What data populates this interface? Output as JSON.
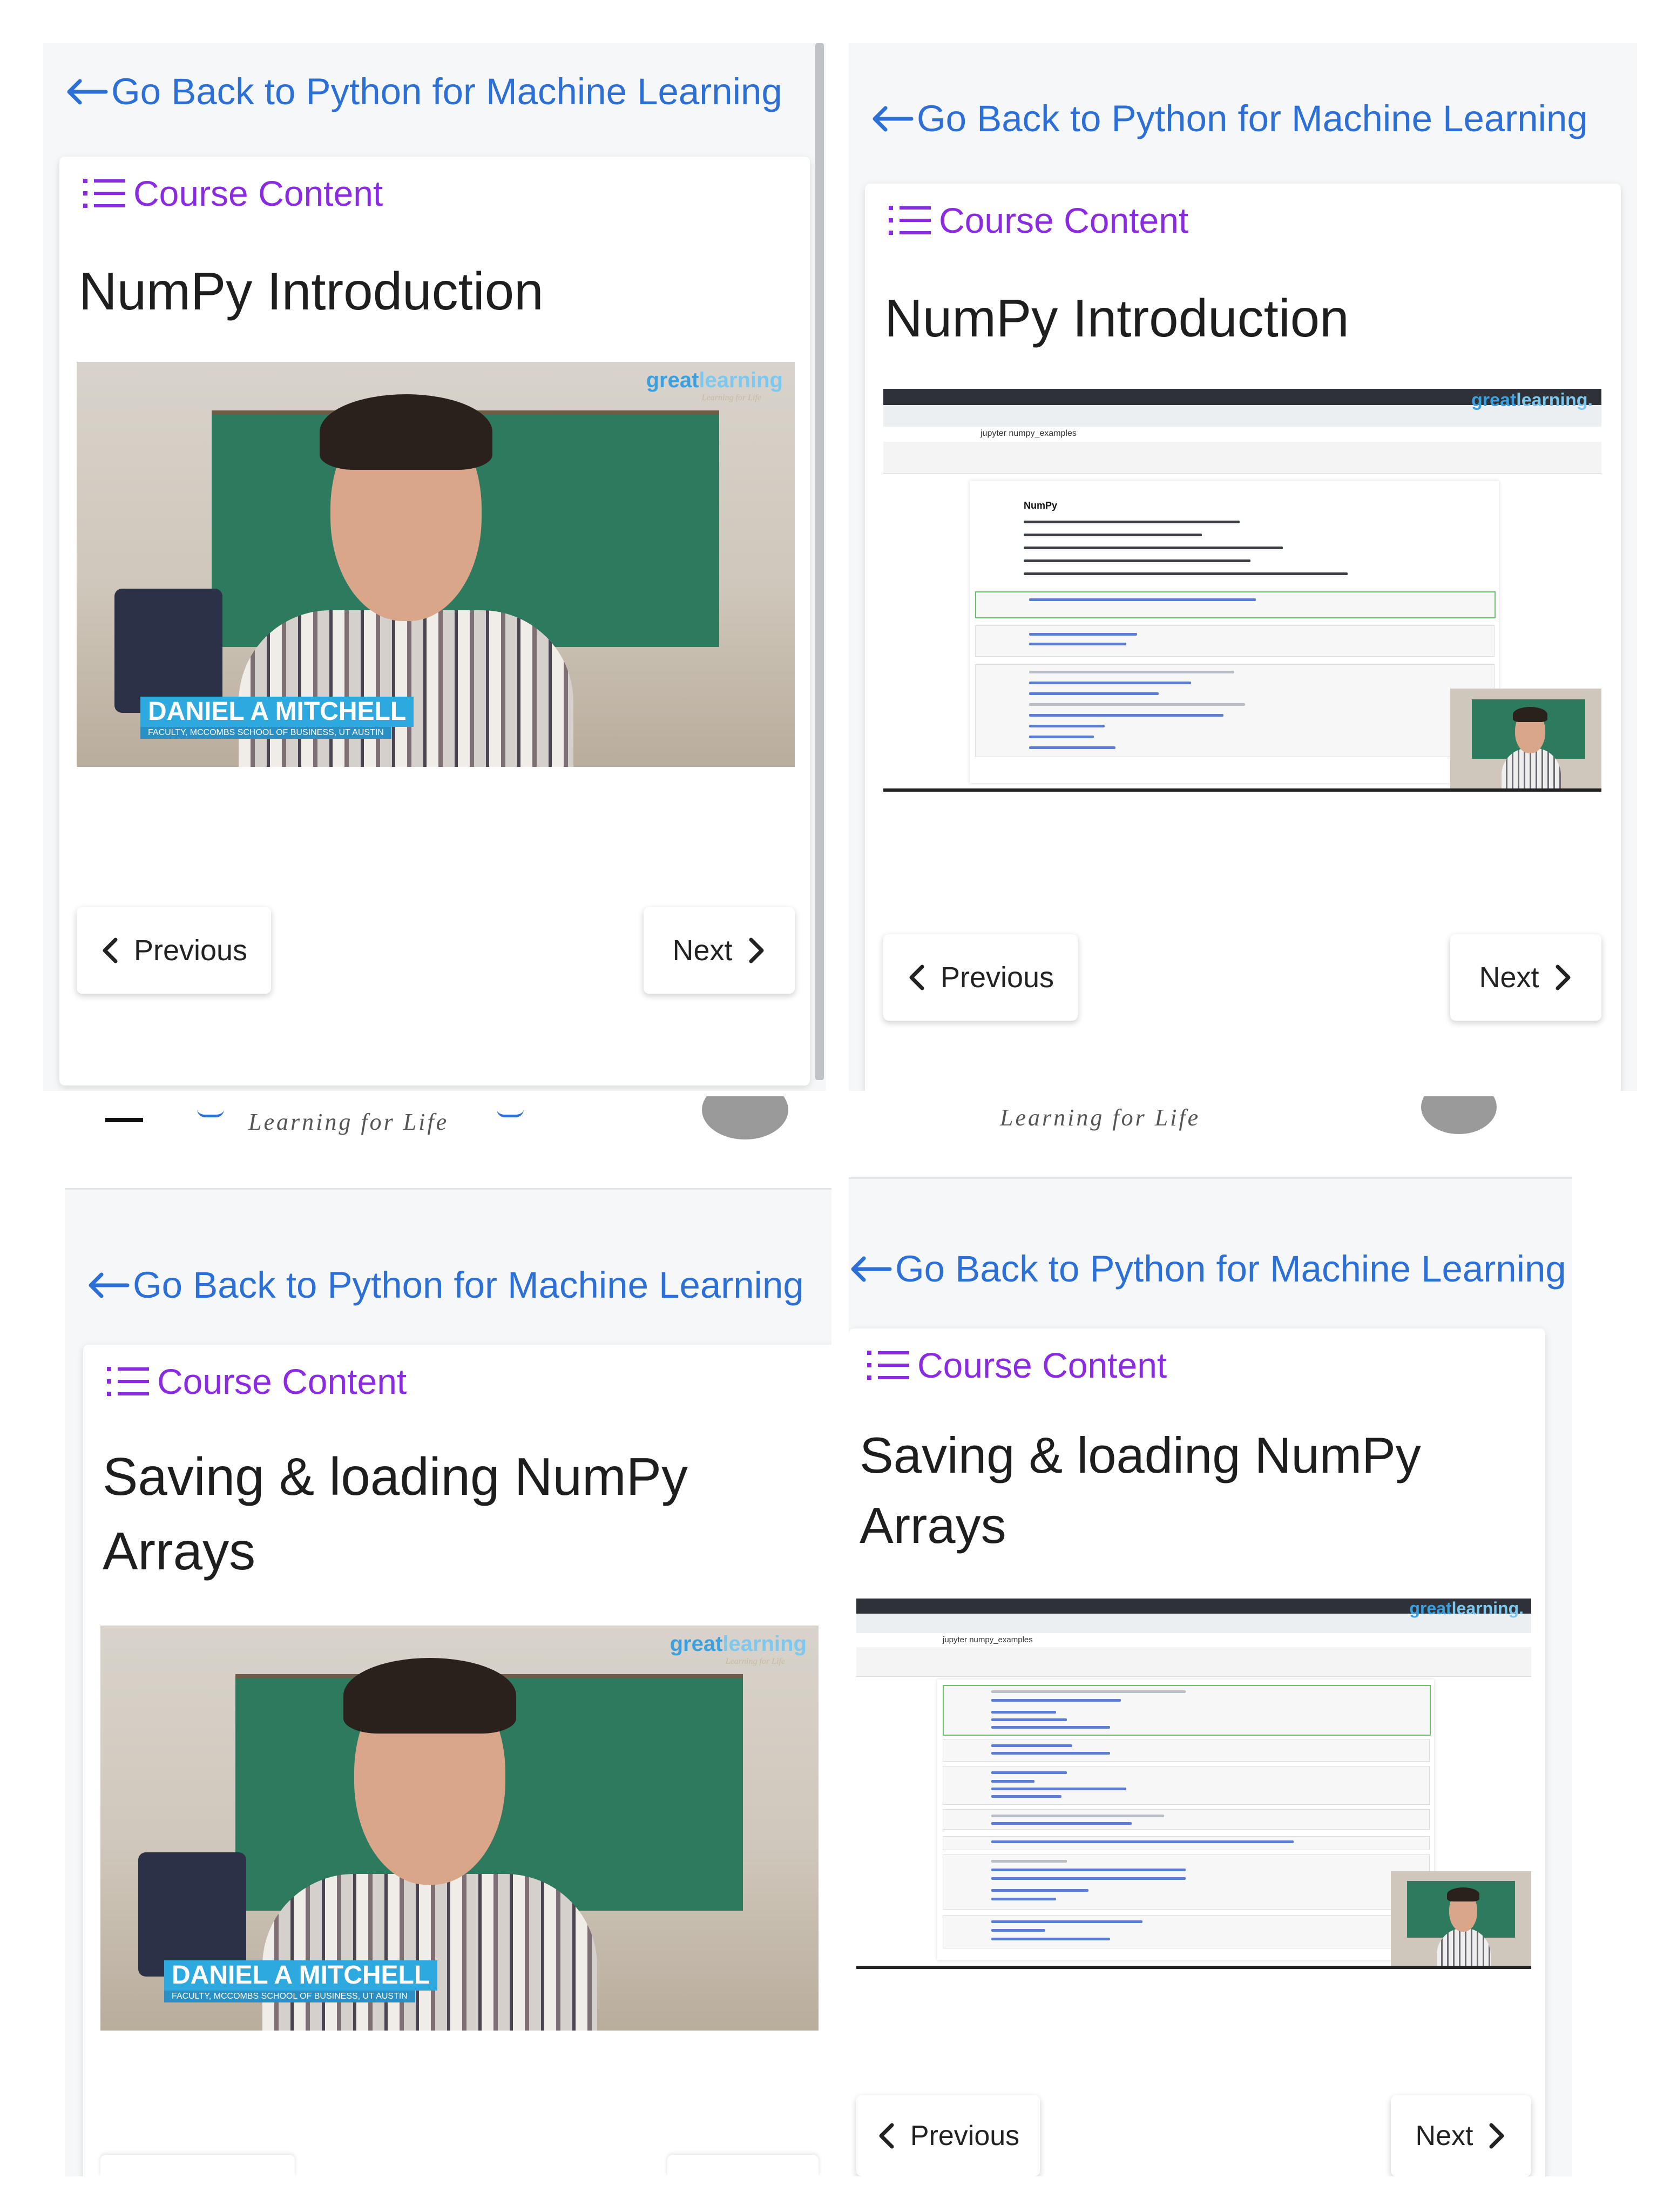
{
  "panels": [
    {
      "back_link": "Go Back to Python for Machine Learning",
      "course_content": "Course Content",
      "lesson_title": "NumPy Introduction",
      "video": {
        "type": "instructor-camera",
        "logo": [
          "great",
          "learning"
        ],
        "logo_tagline": "Learning for Life",
        "name_tag": "DANIEL A MITCHELL",
        "name_tag_sub": "FACULTY, MCCOMBS SCHOOL OF BUSINESS, UT AUSTIN"
      },
      "previous_label": "Previous",
      "next_label": "Next"
    },
    {
      "back_link": "Go Back to Python for Machine Learning",
      "course_content": "Course Content",
      "lesson_title": "NumPy Introduction",
      "video": {
        "type": "notebook-screencast",
        "logo": [
          "great",
          "learning."
        ],
        "notebook_header": "jupyter  numpy_examples",
        "notebook_heading": "NumPy"
      },
      "previous_label": "Previous",
      "next_label": "Next"
    },
    {
      "header_tagline": "Learning for Life",
      "back_link": "Go Back to Python for Machine Learning",
      "course_content": "Course Content",
      "lesson_title": "Saving & loading NumPy Arrays",
      "video": {
        "type": "instructor-camera",
        "logo": [
          "great",
          "learning"
        ],
        "logo_tagline": "Learning for Life",
        "name_tag": "DANIEL A MITCHELL",
        "name_tag_sub": "FACULTY, MCCOMBS SCHOOL OF BUSINESS, UT AUSTIN"
      }
    },
    {
      "header_tagline": "Learning for Life",
      "back_link": "Go Back to Python for Machine Learning",
      "course_content": "Course Content",
      "lesson_title": "Saving & loading NumPy Arrays",
      "video": {
        "type": "notebook-screencast",
        "logo": [
          "great",
          "learning."
        ],
        "notebook_header": "jupyter  numpy_examples"
      },
      "previous_label": "Previous",
      "next_label": "Next"
    }
  ],
  "icons": {
    "back": "arrow-left-icon",
    "course_content": "list-icon",
    "previous": "chevron-left-icon",
    "next": "chevron-right-icon"
  },
  "colors": {
    "link_blue": "#2c6fd6",
    "accent_purple": "#8a2be2",
    "brand_blue": "#3aa0e0"
  }
}
